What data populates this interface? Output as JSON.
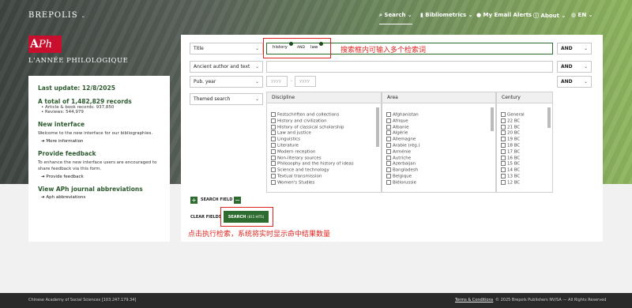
{
  "brand": "BREPOLIS",
  "nav": {
    "search": "Search",
    "biblio": "Bibliometrics",
    "alerts": "My Email Alerts",
    "about": "About",
    "lang": "EN"
  },
  "logo": {
    "a": "A",
    "ph": "Ph",
    "title": "L'ANNÉE PHILOLOGIQUE"
  },
  "sidebar": {
    "last_update": "Last update: 12/8/2025",
    "total": "A total of 1,482,829 records",
    "items": [
      "Article & book records: 937,850",
      "Reviews: 544,979"
    ],
    "new_title": "New interface",
    "new_text": "Welcome to the new interface for our bibliographies.",
    "more": "More information",
    "fb_title": "Provide feedback",
    "fb_text": "To enhance the new interface users are encouraged to share feedback via this form.",
    "fb_link": "Provide feedback",
    "abbr_title": "View APh journal abbreviations",
    "abbr_link": "Aph abbreviations"
  },
  "search": {
    "rows": [
      "Title",
      "Ancient author and text",
      "Pub. year"
    ],
    "ops": [
      "AND",
      "AND",
      "AND"
    ],
    "tokens": [
      "history",
      "AND",
      "law"
    ],
    "year_from": "yyyy",
    "year_to": "yyyy",
    "themed": "Themed search",
    "discipline_head": "Discipline",
    "area_head": "Area",
    "century_head": "Century",
    "disciplines": [
      "Festschriften and collections",
      "History and civilization",
      "History of classical scholarship",
      "Law and justice",
      "Linguistics",
      "Literature",
      "Modern reception",
      "Non-literary sources",
      "Philosophy and the history of ideas",
      "Science and technology",
      "Textual transmission",
      "Women's Studies"
    ],
    "areas": [
      "Afghanistan",
      "Afrique",
      "Albanie",
      "Algérie",
      "Allemagne",
      "Arabie (rég.)",
      "Arménie",
      "Autriche",
      "Azerbaijan",
      "Bangladesh",
      "Belgique",
      "Biélorussie"
    ],
    "centuries": [
      "General",
      "22 BC",
      "21 BC",
      "20 BC",
      "19 BC",
      "18 BC",
      "17 BC",
      "16 BC",
      "15 BC",
      "14 BC",
      "13 BC",
      "12 BC"
    ],
    "search_field": "SEARCH FIELD",
    "clear": "CLEAR FIELDS",
    "search_btn": "SEARCH",
    "hits": "(815 HITS)"
  },
  "annotations": {
    "top": "搜索框内可输入多个检索词",
    "bottom": "点击执行检索，系统将实时显示命中结果数量"
  },
  "footer": {
    "left": "Chinese Academy of Social Sciences [103.247.179.34]",
    "terms": "Terms & Conditions",
    "copy": "© 2025 Brepols Publishers NV/SA — All Rights Reserved"
  },
  "colors": {
    "accent": "#2e6b2e",
    "annotation": "#e0251f",
    "logo": "#c8102e"
  }
}
